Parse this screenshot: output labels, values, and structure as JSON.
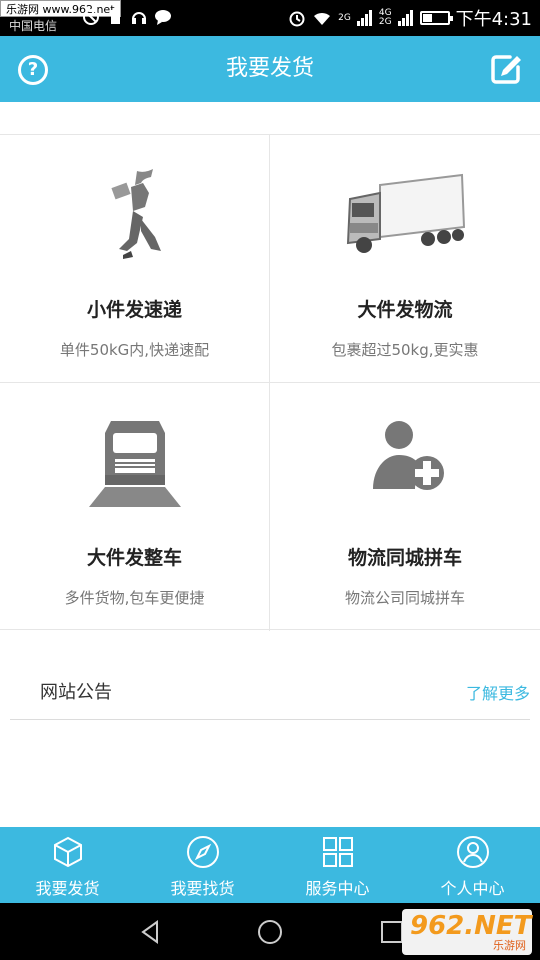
{
  "status_bar": {
    "watermark": "乐游网 www.962.net",
    "carrier": "中国电信",
    "net_small_top": "2G",
    "net_small_mid": "4G",
    "net_small_bot": "2G",
    "time": "下午4:31",
    "battery_level": 0.4
  },
  "header": {
    "title": "我要发货",
    "help_icon": "question-circle-icon",
    "edit_icon": "edit-square-icon"
  },
  "services": [
    {
      "title": "小件发速递",
      "desc": "单件50kG内,快递速配",
      "icon": "courier-running-icon"
    },
    {
      "title": "大件发物流",
      "desc": "包裹超过50kg,更实惠",
      "icon": "box-truck-icon"
    },
    {
      "title": "大件发整车",
      "desc": "多件货物,包车更便捷",
      "icon": "truck-front-icon"
    },
    {
      "title": "物流同城拼车",
      "desc": "物流公司同城拼车",
      "icon": "user-add-icon"
    }
  ],
  "notice": {
    "label": "网站公告",
    "more": "了解更多"
  },
  "tabs": [
    {
      "label": "我要发货",
      "icon": "cube-icon"
    },
    {
      "label": "我要找货",
      "icon": "compass-icon"
    },
    {
      "label": "服务中心",
      "icon": "grid-icon"
    },
    {
      "label": "个人中心",
      "icon": "user-icon"
    }
  ],
  "watermark_logo": {
    "big": "962.NET",
    "sub": "乐游网"
  },
  "colors": {
    "accent": "#3cb9e0",
    "link": "#3cb9e0"
  }
}
